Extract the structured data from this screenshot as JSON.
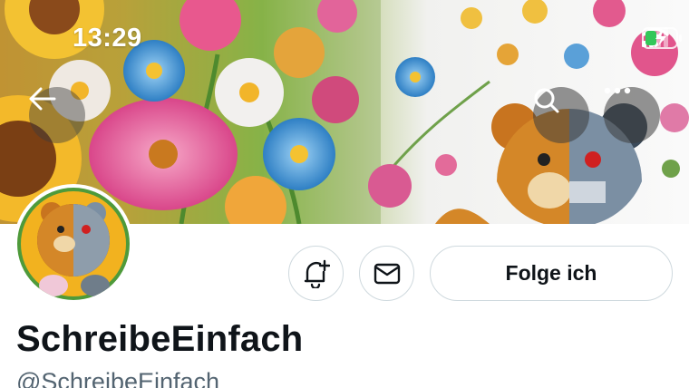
{
  "status_bar": {
    "time": "13:29",
    "icons": [
      "signal-icon",
      "wifi-icon",
      "battery-charging-icon"
    ]
  },
  "header": {
    "back_icon": "arrow-left-icon",
    "search_icon": "search-icon",
    "more_icon": "more-horizontal-icon"
  },
  "profile": {
    "display_name": "SchreibeEinfach",
    "handle": "@SchreibeEinfach"
  },
  "actions": {
    "notify_icon": "bell-plus-icon",
    "message_icon": "envelope-icon",
    "follow_label": "Folge ich"
  },
  "colors": {
    "text_primary": "#0f1419",
    "text_secondary": "#536471",
    "border": "#cfd9de"
  }
}
